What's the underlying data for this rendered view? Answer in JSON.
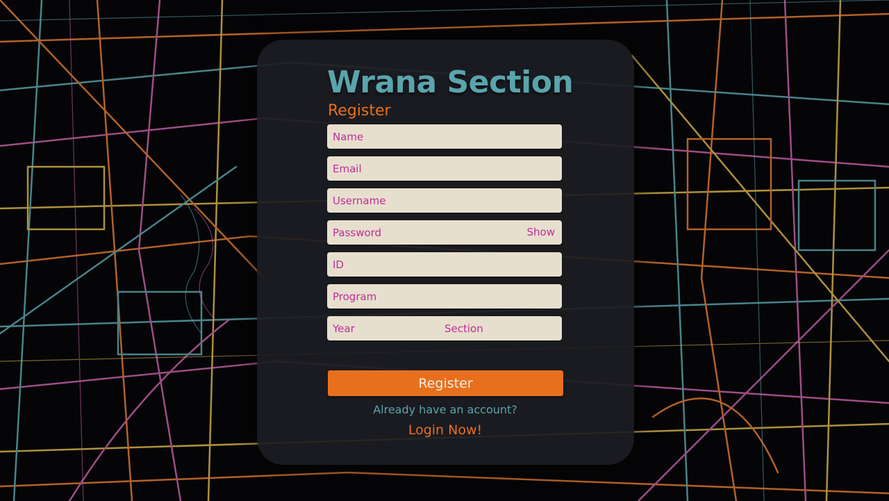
{
  "app": {
    "brand": "Wrana Section",
    "form_title": "Register"
  },
  "fields": {
    "name": "Name",
    "email": "Email",
    "username": "Username",
    "password": "Password",
    "password_toggle": "Show",
    "id": "ID",
    "program": "Program",
    "year": "Year",
    "section": "Section"
  },
  "actions": {
    "register_label": "Register",
    "already_prompt": "Already have an account?",
    "login_label": "Login Now!"
  },
  "colors": {
    "accent": "#e8701d",
    "brand": "#5aa4ad",
    "input_bg": "#e7dfce",
    "input_text": "#c02c96",
    "card_bg": "#1c1d22"
  },
  "background": "dark-neon-city-map"
}
